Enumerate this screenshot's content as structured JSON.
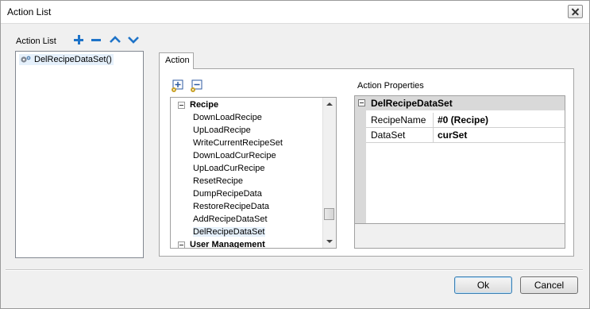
{
  "window": {
    "title": "Action List"
  },
  "action_list": {
    "label": "Action List",
    "toolbar": [
      "add-icon",
      "remove-icon",
      "move-up-icon",
      "move-down-icon"
    ],
    "items": [
      {
        "label": "DelRecipeDataSet()",
        "icon": "gear-icon"
      }
    ]
  },
  "tab": {
    "label": "Action"
  },
  "tree": {
    "group": "Recipe",
    "items": [
      "DownLoadRecipe",
      "UpLoadRecipe",
      "WriteCurrentRecipeSet",
      "DownLoadCurRecipe",
      "UpLoadCurRecipe",
      "ResetRecipe",
      "DumpRecipeData",
      "RestoreRecipeData",
      "AddRecipeDataSet",
      "DelRecipeDataSet"
    ],
    "next_group": "User Management",
    "selected": "DelRecipeDataSet"
  },
  "properties": {
    "label": "Action Properties",
    "header": "DelRecipeDataSet",
    "rows": [
      {
        "name": "RecipeName",
        "value": "#0 (Recipe)"
      },
      {
        "name": "DataSet",
        "value": "curSet"
      }
    ]
  },
  "buttons": {
    "ok": "Ok",
    "cancel": "Cancel"
  },
  "colors": {
    "accent": "#1e73c8",
    "selection": "#e5f0fb"
  }
}
